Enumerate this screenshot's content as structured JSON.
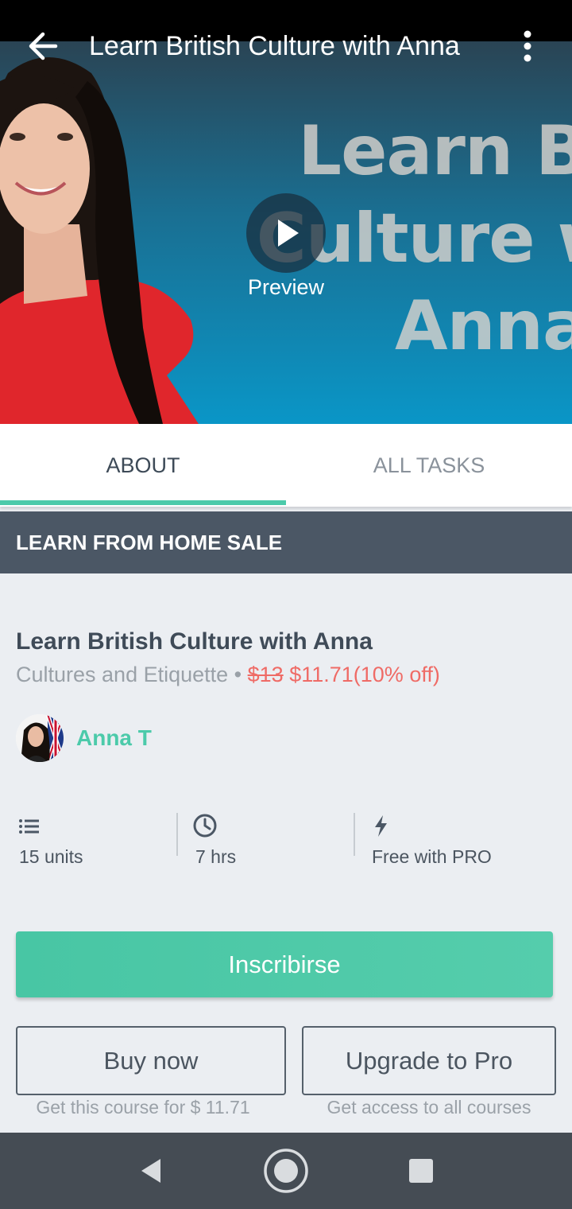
{
  "header": {
    "title": "Learn British Culture with Anna",
    "back_icon": "arrow-left-icon",
    "more_icon": "more-vert-icon"
  },
  "hero": {
    "bg_lines": [
      "Learn Br",
      "Culture w",
      "Anna"
    ],
    "play_icon": "play-icon",
    "preview_label": "Preview"
  },
  "tabs": [
    {
      "label": "ABOUT",
      "selected": true
    },
    {
      "label": "ALL TASKS",
      "selected": false
    }
  ],
  "sale_banner": "LEARN FROM HOME SALE",
  "course": {
    "title": "Learn British Culture with Anna",
    "category": "Cultures and Etiquette",
    "separator": " • ",
    "old_price": "$13",
    "new_price": " $11.71(10% off)"
  },
  "author": {
    "name": "Anna T"
  },
  "stats": [
    {
      "icon": "list-icon",
      "label": "15 units"
    },
    {
      "icon": "clock-icon",
      "label": "7 hrs"
    },
    {
      "icon": "lightning-icon",
      "label": "Free with PRO"
    }
  ],
  "actions": {
    "enroll": "Inscribirse",
    "buy_now": "Buy now",
    "buy_caption": "Get this course for $ 11.71",
    "upgrade": "Upgrade to Pro",
    "upgrade_caption": "Get access to all courses"
  },
  "colors": {
    "accent": "#4ccaaa",
    "sale_red": "#ef6b66",
    "banner": "#4b5765"
  }
}
